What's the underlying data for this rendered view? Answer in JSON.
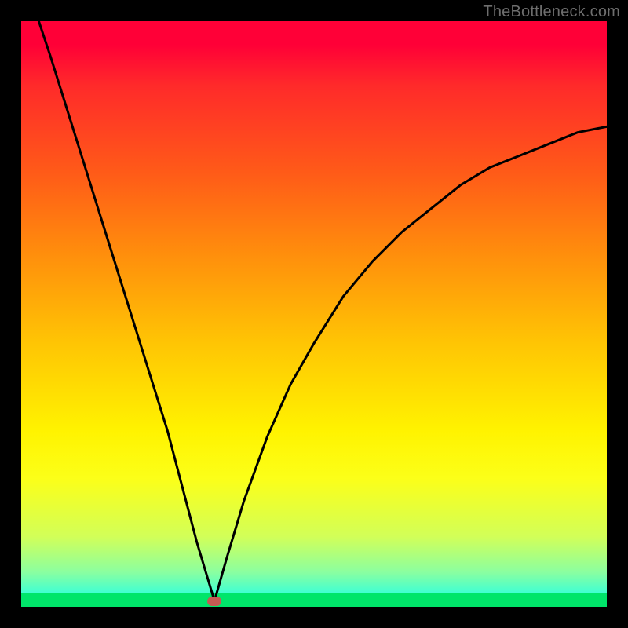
{
  "watermark": "TheBottleneck.com",
  "colors": {
    "frame": "#000000",
    "curve": "#000000",
    "marker": "#c45b53",
    "green_band": "#00e56a"
  },
  "chart_data": {
    "type": "line",
    "title": "",
    "xlabel": "",
    "ylabel": "",
    "xlim": [
      0,
      100
    ],
    "ylim": [
      0,
      100
    ],
    "legend": false,
    "grid": false,
    "background": "vertical gradient red→orange→yellow→green",
    "annotations": [
      {
        "type": "marker",
        "x": 33,
        "y": 1,
        "shape": "rounded-rect",
        "color": "#c45b53"
      }
    ],
    "series": [
      {
        "name": "left-branch",
        "x": [
          3,
          5,
          10,
          15,
          20,
          25,
          30,
          33
        ],
        "values": [
          100,
          94,
          78,
          62,
          46,
          30,
          11,
          1
        ]
      },
      {
        "name": "right-branch",
        "x": [
          33,
          35,
          38,
          42,
          46,
          50,
          55,
          60,
          65,
          70,
          75,
          80,
          85,
          90,
          95,
          100
        ],
        "values": [
          1,
          8,
          18,
          29,
          38,
          45,
          53,
          59,
          64,
          68,
          72,
          75,
          77,
          79,
          81,
          82
        ]
      }
    ]
  }
}
